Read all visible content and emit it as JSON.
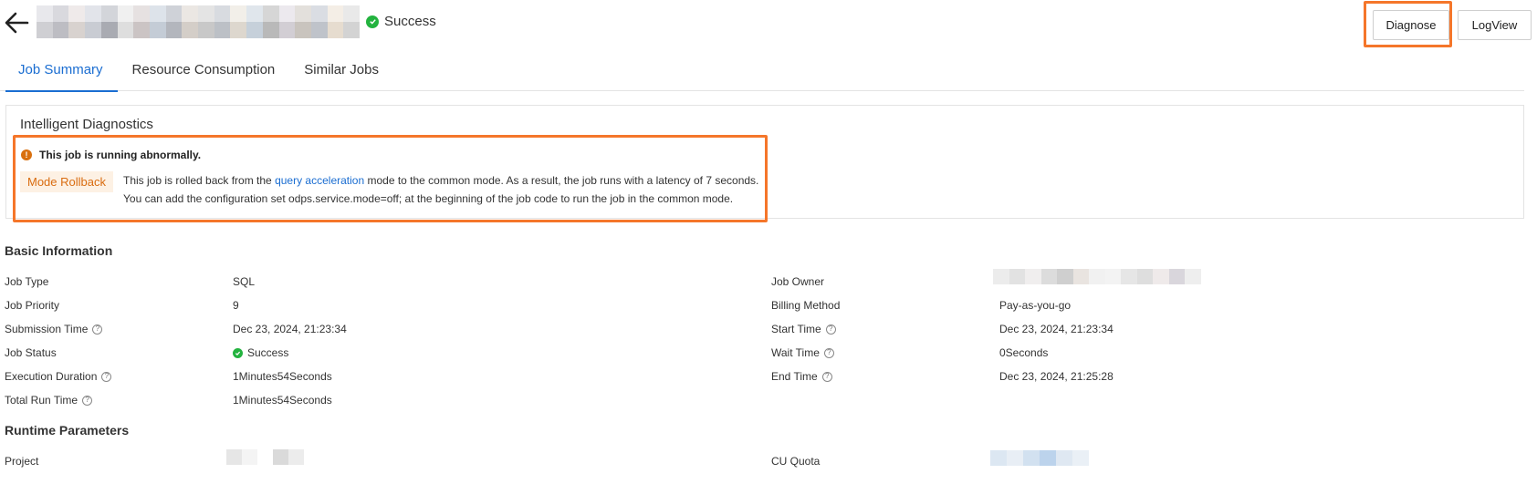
{
  "header": {
    "status": "Success",
    "actions": {
      "diagnose": "Diagnose",
      "logview": "LogView"
    }
  },
  "tabs": [
    {
      "label": "Job Summary",
      "active": true
    },
    {
      "label": "Resource Consumption",
      "active": false
    },
    {
      "label": "Similar Jobs",
      "active": false
    }
  ],
  "diagnostics": {
    "title": "Intelligent Diagnostics",
    "warning": "This job is running abnormally.",
    "tag": "Mode Rollback",
    "line1_prefix": "This job is rolled back from the ",
    "line1_link": "query acceleration",
    "line1_suffix": " mode to the common mode. As a result, the job runs with a latency of 7 seconds.",
    "line2": "You can add the configuration set odps.service.mode=off; at the beginning of the job code to run the job in the common mode."
  },
  "basic_info": {
    "title": "Basic Information",
    "left": [
      {
        "label": "Job Type",
        "value": "SQL",
        "help": false
      },
      {
        "label": "Job Priority",
        "value": "9",
        "help": false
      },
      {
        "label": "Submission Time",
        "value": "Dec 23, 2024, 21:23:34",
        "help": true
      },
      {
        "label": "Job Status",
        "value": "Success",
        "help": false
      },
      {
        "label": "Execution Duration",
        "value": "1Minutes54Seconds",
        "help": true
      },
      {
        "label": "Total Run Time",
        "value": "1Minutes54Seconds",
        "help": true
      }
    ],
    "right": [
      {
        "label": "Job Owner",
        "value": "",
        "help": false
      },
      {
        "label": "Billing Method",
        "value": "Pay-as-you-go",
        "help": false
      },
      {
        "label": "Start Time",
        "value": "Dec 23, 2024, 21:23:34",
        "help": true
      },
      {
        "label": "Wait Time",
        "value": "0Seconds",
        "help": true
      },
      {
        "label": "End Time",
        "value": "Dec 23, 2024, 21:25:28",
        "help": true
      }
    ]
  },
  "runtime_params": {
    "title": "Runtime Parameters",
    "project_label": "Project",
    "cu_quota_label": "CU Quota"
  },
  "colors": {
    "accent": "#1a6dd1",
    "highlight": "#f5762a",
    "success": "#23b33f",
    "warning": "#d9700f"
  },
  "icons": {
    "back": "back-arrow-icon",
    "success": "check-circle-icon",
    "warning": "exclamation-circle-icon",
    "help": "question-circle-icon"
  }
}
